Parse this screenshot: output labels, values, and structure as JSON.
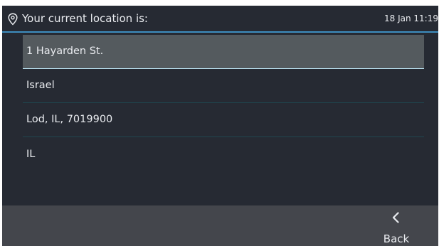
{
  "header": {
    "title": "Your current location is:",
    "datetime": "18 Jan 11:19",
    "icon": "location-pin-icon"
  },
  "location_lines": [
    {
      "text": "1 Hayarden St.",
      "selected": true
    },
    {
      "text": "Israel",
      "selected": false
    },
    {
      "text": "Lod, IL, 7019900",
      "selected": false
    },
    {
      "text": "IL",
      "selected": false
    }
  ],
  "footer": {
    "back_label": "Back",
    "back_icon": "chevron-left-icon"
  },
  "colors": {
    "background": "#262a33",
    "selected_row": "#545a5e",
    "accent": "#3e8ec0",
    "footer": "#44464c",
    "text": "#e9ebef"
  }
}
